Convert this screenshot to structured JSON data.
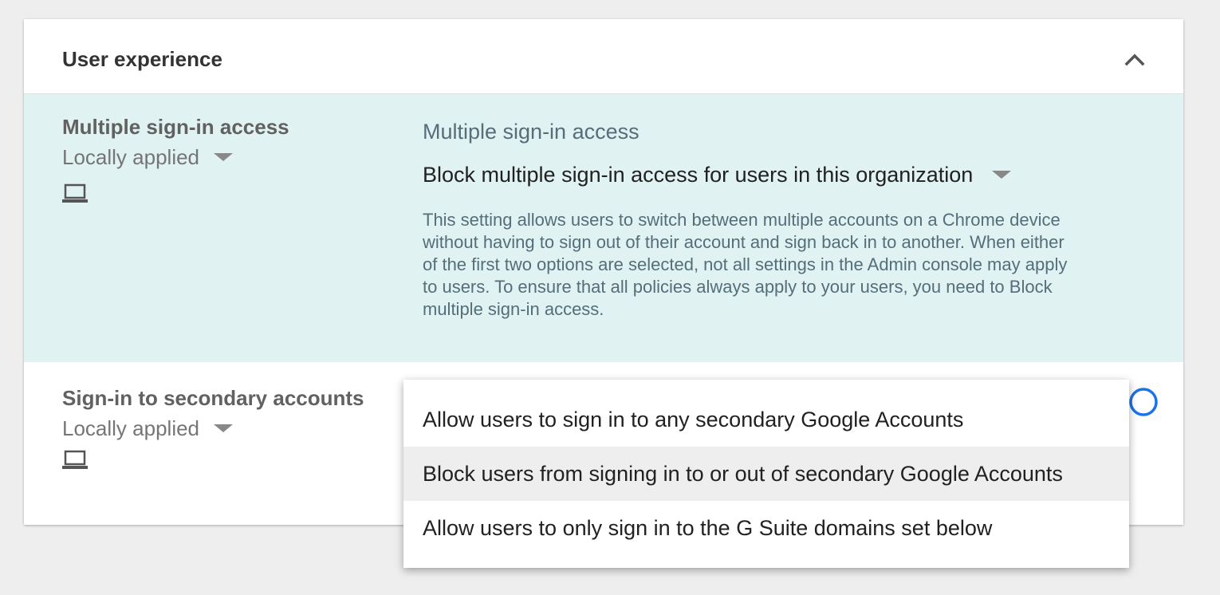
{
  "section": {
    "title": "User experience",
    "collapse_icon": "chevron-up-icon"
  },
  "settings": [
    {
      "name": "Multiple sign-in access",
      "inheritance": "Locally applied",
      "device_icon": "laptop-icon",
      "field_label": "Multiple sign-in access",
      "selected_value": "Block multiple sign-in access for users in this organization",
      "description": "This setting allows users to switch between multiple accounts on a Chrome device without having to sign out of their account and sign back in to another. When either of the first two options are selected, not all settings in the Admin console may apply to users. To ensure that all policies always apply to your users, you need to Block multiple sign-in access."
    },
    {
      "name": "Sign-in to secondary accounts",
      "inheritance": "Locally applied",
      "device_icon": "laptop-icon",
      "help_icon": "help-icon"
    }
  ],
  "dropdown": {
    "options": [
      "Allow users to sign in to any secondary Google Accounts",
      "Block users from signing in to or out of secondary Google Accounts",
      "Allow users to only sign in to the G Suite domains set below"
    ],
    "highlighted_index": 1
  },
  "colors": {
    "page_background": "#eeeeee",
    "highlight_row": "#e0f2f1",
    "accent_blue": "#1a73e8"
  }
}
